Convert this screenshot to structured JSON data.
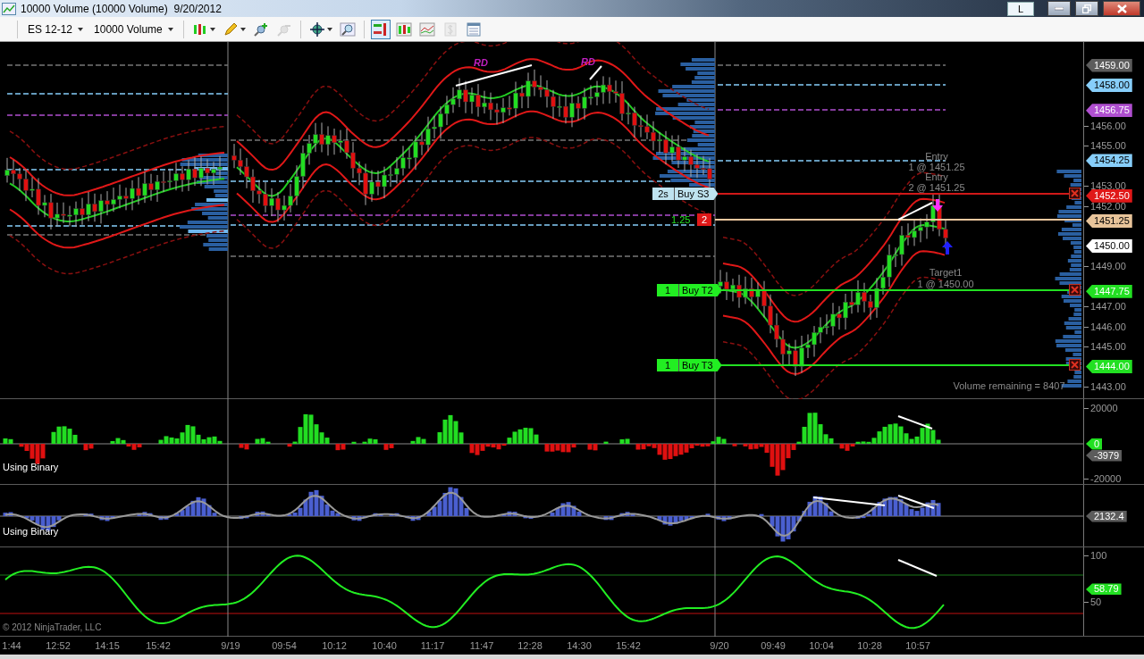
{
  "window": {
    "title": "10000 Volume (10000 Volume)  9/20/2012",
    "mode_button": "L"
  },
  "toolbar": {
    "instrument": "ES 12-12",
    "bars_period": "10000 Volume",
    "tools": [
      {
        "kind": "bar-style",
        "selected": false,
        "disabled": false
      },
      {
        "kind": "draw",
        "selected": false,
        "disabled": false
      },
      {
        "kind": "zoom-in",
        "selected": false,
        "disabled": false
      },
      {
        "kind": "zoom-out",
        "selected": false,
        "disabled": true
      },
      {
        "kind": "crosshair",
        "selected": false,
        "disabled": false
      },
      {
        "kind": "find",
        "selected": false,
        "disabled": false
      },
      {
        "kind": "chart-trader",
        "selected": true,
        "disabled": false
      },
      {
        "kind": "bars",
        "selected": false,
        "disabled": false
      },
      {
        "kind": "indicators",
        "selected": false,
        "disabled": false
      },
      {
        "kind": "money",
        "selected": false,
        "disabled": true
      },
      {
        "kind": "properties",
        "selected": false,
        "disabled": false
      }
    ]
  },
  "price_panel": {
    "axis_ticks": [
      "1456.00",
      "1455.00",
      "1453.00",
      "1452.00",
      "1449.00",
      "1447.00",
      "1446.00",
      "1445.00",
      "1443.00"
    ],
    "price_markers": [
      {
        "label": "1459.00",
        "color": "#5c5c5c"
      },
      {
        "label": "1458.00",
        "color": "#87cefa"
      },
      {
        "label": "1456.75",
        "color": "#b04fd0"
      },
      {
        "label": "1454.25",
        "color": "#87cefa"
      },
      {
        "label": "1452.50",
        "color": "#e01818"
      },
      {
        "label": "1451.25",
        "color": "#e8c49a"
      },
      {
        "label": "1450.00",
        "color": "#ffffff"
      },
      {
        "label": "1447.75",
        "color": "#22e022"
      },
      {
        "label": "1444.00",
        "color": "#22e022"
      }
    ],
    "orders": [
      {
        "kind": "stop",
        "quantity": "2s",
        "label": "Buy S3"
      },
      {
        "kind": "position",
        "profit": "1.25",
        "quantity": "2"
      },
      {
        "kind": "target",
        "quantity": "1",
        "label": "Buy T2"
      },
      {
        "kind": "target",
        "quantity": "1",
        "label": "Buy T3"
      }
    ],
    "annotations": [
      "Entry",
      "1 @ 1451.25",
      "Entry",
      "2 @ 1451.25",
      "Target1",
      "1 @ 1450.00"
    ],
    "divergence_labels": [
      "RD",
      "RD"
    ],
    "volume_remaining": "Volume remaining = 8407"
  },
  "indicator_panels": [
    {
      "kind": "histogram",
      "label": "Using Binary",
      "axis_ticks": [
        "20000",
        "-20000"
      ],
      "markers": [
        {
          "label": "0",
          "color": "#22e022"
        },
        {
          "label": "-3979",
          "color": "#5c5c5c"
        }
      ]
    },
    {
      "kind": "bars_line",
      "label": "Using Binary",
      "markers": [
        {
          "label": "2132.4",
          "color": "#5c5c5c"
        }
      ]
    },
    {
      "kind": "oscillator",
      "axis_ticks": [
        "100",
        "50"
      ],
      "markers": [
        {
          "label": "58.79",
          "color": "#22e022"
        }
      ],
      "copyright": "© 2012 NinjaTrader, LLC"
    }
  ],
  "time_axis": [
    "1:44",
    "12:52",
    "14:15",
    "15:42",
    "9/19",
    "09:54",
    "10:12",
    "10:40",
    "11:17",
    "11:47",
    "12:28",
    "14:30",
    "15:42",
    "9/20",
    "09:49",
    "10:04",
    "10:28",
    "10:57"
  ]
}
